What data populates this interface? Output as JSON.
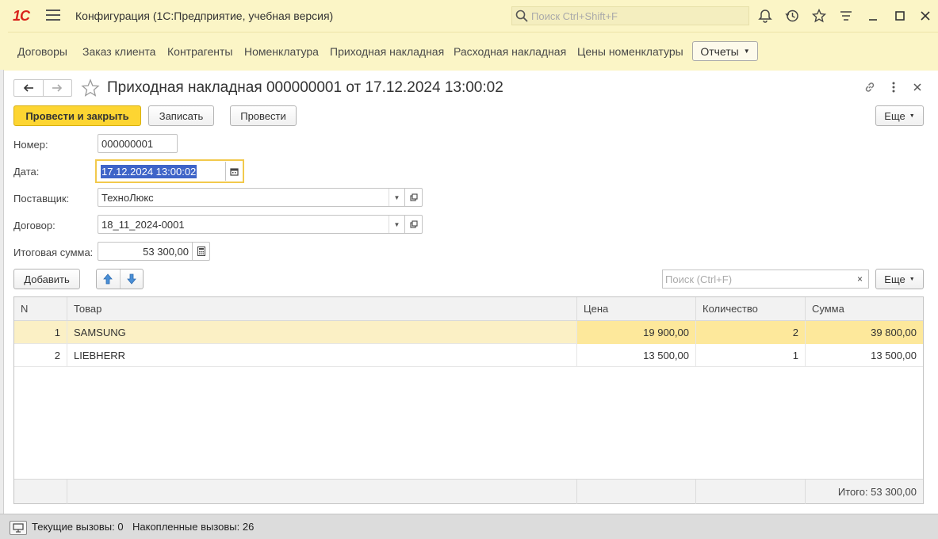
{
  "app": {
    "logo": "1С",
    "title": "Конфигурация  (1С:Предприятие, учебная версия)",
    "search_placeholder": "Поиск Ctrl+Shift+F",
    "brand_color": "#d9231b"
  },
  "sections": {
    "items": [
      "Договоры",
      "Заказ клиента",
      "Контрагенты",
      "Номенклатура",
      "Приходная накладная",
      "Расходная накладная",
      "Цены номенклатуры"
    ],
    "reports_label": "Отчеты"
  },
  "form": {
    "title": "Приходная накладная 000000001 от 17.12.2024 13:00:02",
    "toolbar": {
      "post_close": "Провести и закрыть",
      "save": "Записать",
      "post": "Провести",
      "more": "Еще"
    },
    "fields": {
      "number_label": "Номер:",
      "number_value": "000000001",
      "date_label": "Дата:",
      "date_value": "17.12.2024 13:00:02",
      "supplier_label": "Поставщик:",
      "supplier_value": "ТехноЛюкс",
      "contract_label": "Договор:",
      "contract_value": "18_11_2024-0001",
      "total_label": "Итоговая сумма:",
      "total_value": "53 300,00"
    },
    "table_toolbar": {
      "add": "Добавить",
      "search_placeholder": "Поиск (Ctrl+F)",
      "clear": "×",
      "more": "Еще"
    },
    "table": {
      "columns": [
        "N",
        "Товар",
        "Цена",
        "Количество",
        "Сумма"
      ],
      "rows": [
        {
          "n": "1",
          "item": "SAMSUNG",
          "price": "19 900,00",
          "qty": "2",
          "sum": "39 800,00"
        },
        {
          "n": "2",
          "item": "LIEBHERR",
          "price": "13 500,00",
          "qty": "1",
          "sum": "13 500,00"
        }
      ],
      "footer_total": "Итого: 53 300,00"
    }
  },
  "status": {
    "current_calls": "Текущие вызовы: 0",
    "accumulated_calls": "Накопленные вызовы: 26"
  }
}
